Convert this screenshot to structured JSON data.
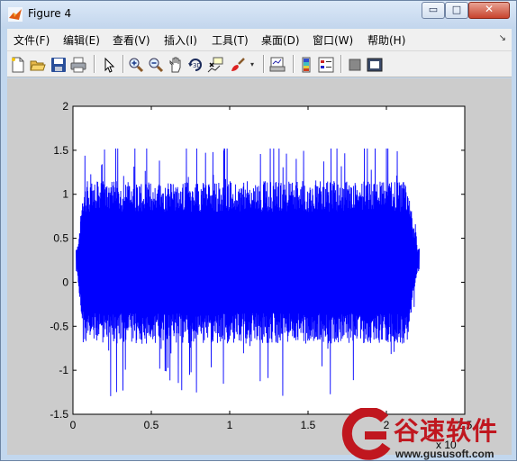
{
  "window": {
    "title": "Figure 4",
    "buttons": {
      "minimize": "▭",
      "maximize": "□",
      "close": "✕"
    }
  },
  "menu": {
    "items": [
      "文件(F)",
      "编辑(E)",
      "查看(V)",
      "插入(I)",
      "工具(T)",
      "桌面(D)",
      "窗口(W)",
      "帮助(H)"
    ]
  },
  "toolbar": {
    "icons": [
      "new-figure-icon",
      "open-file-icon",
      "save-icon",
      "print-icon",
      "pointer-icon",
      "zoom-in-icon",
      "zoom-out-icon",
      "pan-icon",
      "rotate-3d-icon",
      "data-cursor-icon",
      "brush-icon",
      "link-plot-icon",
      "colorbar-icon",
      "legend-icon",
      "hide-plot-tools-icon",
      "show-plot-tools-icon"
    ]
  },
  "chart_data": {
    "type": "line",
    "title": "",
    "xlabel": "",
    "ylabel": "",
    "xlim": [
      0,
      2.5
    ],
    "ylim": [
      -1.5,
      2
    ],
    "x_ticks": [
      "0",
      "0.5",
      "1",
      "1.5",
      "2",
      "2.5"
    ],
    "y_ticks": [
      "2",
      "1.5",
      "1",
      "0.5",
      "0",
      "-0.5",
      "-1",
      "-1.5"
    ],
    "x_exponent_label": "x 10",
    "grid": false,
    "series": [
      {
        "color": "#0000ff",
        "x_range": [
          0.02,
          2.21
        ],
        "y_range": [
          -1.35,
          1.52
        ]
      }
    ]
  },
  "watermark": {
    "cn": "谷速软件",
    "url": "www.gususoft.com"
  }
}
